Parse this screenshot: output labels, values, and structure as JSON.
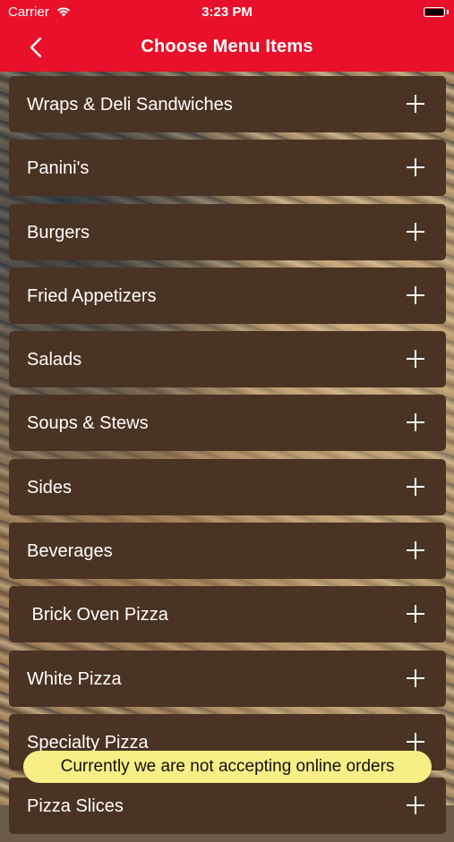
{
  "status_bar": {
    "carrier": "Carrier",
    "time": "3:23 PM"
  },
  "nav": {
    "title": "Choose Menu Items"
  },
  "menu": {
    "items": [
      {
        "label": "Wraps & Deli Sandwiches"
      },
      {
        "label": "Panini's"
      },
      {
        "label": "Burgers"
      },
      {
        "label": "Fried Appetizers"
      },
      {
        "label": "Salads"
      },
      {
        "label": "Soups & Stews"
      },
      {
        "label": "Sides"
      },
      {
        "label": "Beverages"
      },
      {
        "label": " Brick Oven Pizza"
      },
      {
        "label": "White Pizza"
      },
      {
        "label": "Specialty Pizza"
      },
      {
        "label": "Pizza Slices"
      }
    ]
  },
  "notice": {
    "text": "Currently we are not accepting online orders"
  },
  "colors": {
    "nav_red": "#e8102a",
    "item_brown": "#4a3323",
    "notice_yellow": "#f7ee86"
  }
}
